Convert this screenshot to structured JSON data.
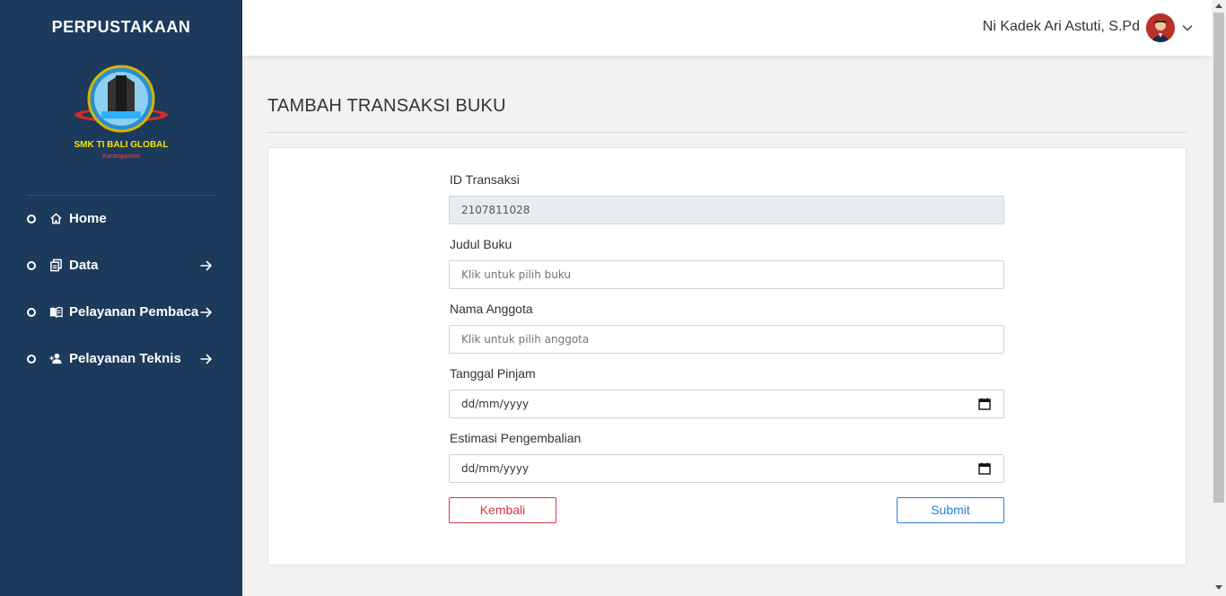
{
  "sidebar": {
    "brand": "PERPUSTAKAAN",
    "logo_text": "SMK TI BALI GLOBAL",
    "logo_subtext": "Karangasem",
    "items": [
      {
        "label": "Home",
        "icon": "home-icon",
        "has_arrow": false
      },
      {
        "label": "Data",
        "icon": "copy-icon",
        "has_arrow": true
      },
      {
        "label": "Pelayanan Pembaca",
        "icon": "book-open-icon",
        "has_arrow": true
      },
      {
        "label": "Pelayanan Teknis",
        "icon": "user-plus-icon",
        "has_arrow": true
      }
    ]
  },
  "topbar": {
    "user_name": "Ni Kadek Ari Astuti, S.Pd"
  },
  "page": {
    "title": "TAMBAH TRANSAKSI BUKU"
  },
  "form": {
    "id_label": "ID Transaksi",
    "id_value": "2107811028",
    "book_label": "Judul Buku",
    "book_placeholder": "Klik untuk pilih buku",
    "member_label": "Nama Anggota",
    "member_placeholder": "Klik untuk pilih anggota",
    "loan_date_label": "Tanggal Pinjam",
    "loan_date_placeholder": "dd/mm/yyyy",
    "return_label": "Estimasi Pengembalian",
    "return_placeholder": "dd/mm/yyyy",
    "back_label": "Kembali",
    "submit_label": "Submit"
  },
  "colors": {
    "sidebar_bg": "#1b3a5c",
    "back_button": "#dc3545",
    "submit_button": "#2a7fd4"
  }
}
